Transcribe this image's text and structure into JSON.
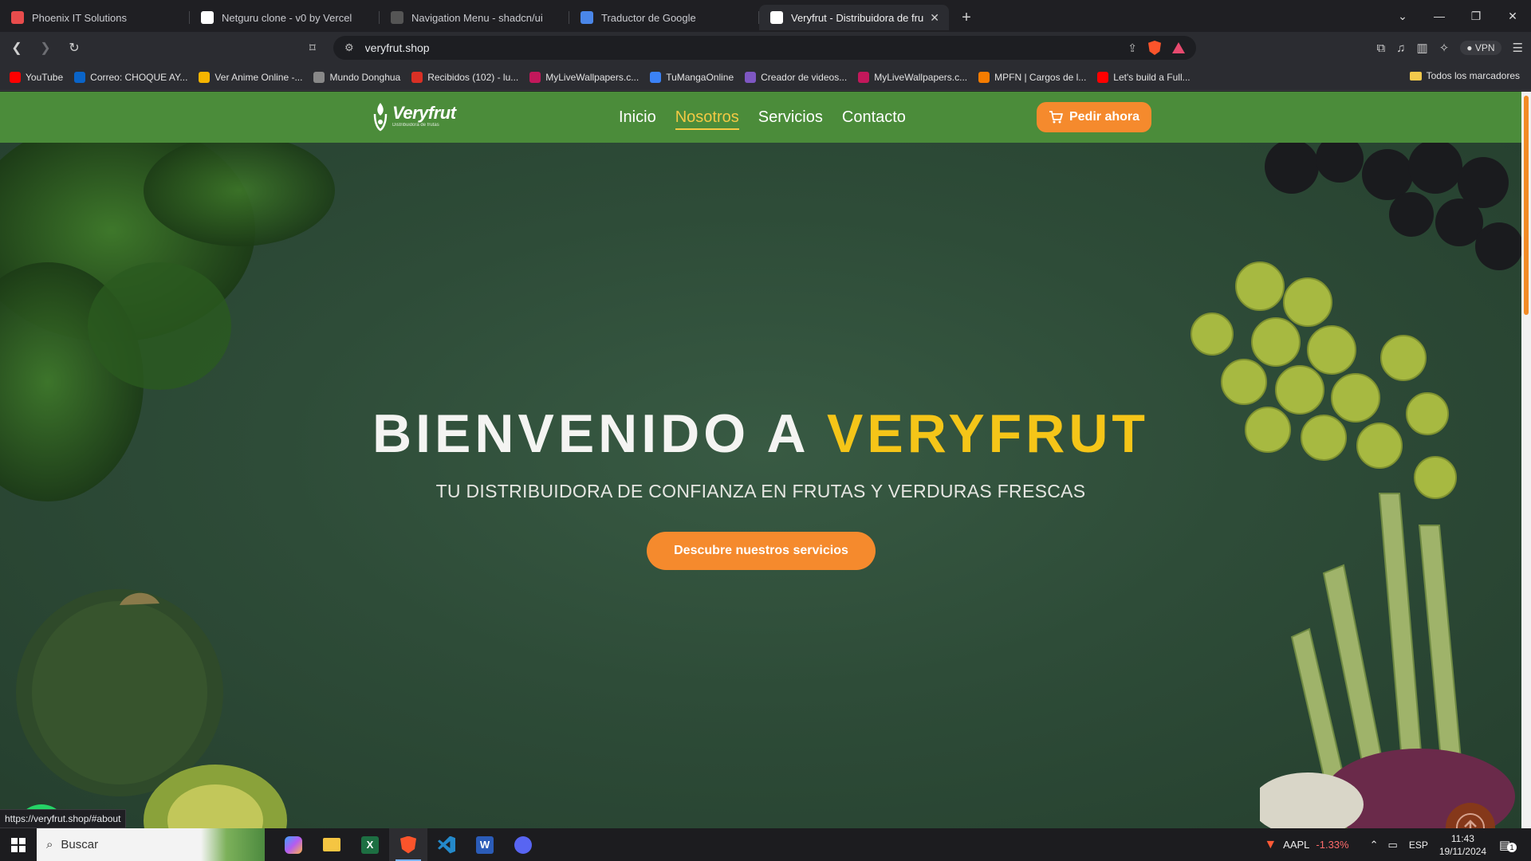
{
  "browser": {
    "tabs": [
      {
        "title": "Phoenix IT Solutions",
        "favicon_color": "#e84c4c",
        "active": false
      },
      {
        "title": "Netguru clone - v0 by Vercel",
        "favicon_color": "#ffffff",
        "active": false
      },
      {
        "title": "Navigation Menu - shadcn/ui",
        "favicon_color": "#555555",
        "active": false
      },
      {
        "title": "Traductor de Google",
        "favicon_color": "#4a86e8",
        "active": false
      },
      {
        "title": "Veryfrut - Distribuidora de frutas",
        "favicon_color": "#ffffff",
        "active": true
      }
    ],
    "url": "veryfrut.shop",
    "vpn_label": "VPN",
    "bookmarks": [
      {
        "label": "YouTube",
        "color": "#ff0000"
      },
      {
        "label": "Correo: CHOQUE AY...",
        "color": "#0a64c8"
      },
      {
        "label": "Ver Anime Online -...",
        "color": "#f5b400"
      },
      {
        "label": "Mundo Donghua",
        "color": "#888888"
      },
      {
        "label": "Recibidos (102) - lu...",
        "color": "#d93025"
      },
      {
        "label": "MyLiveWallpapers.c...",
        "color": "#c2185b"
      },
      {
        "label": "TuMangaOnline",
        "color": "#3b82f6"
      },
      {
        "label": "Creador de videos...",
        "color": "#7e57c2"
      },
      {
        "label": "MyLiveWallpapers.c...",
        "color": "#c2185b"
      },
      {
        "label": "MPFN | Cargos de l...",
        "color": "#f57c00"
      },
      {
        "label": "Let's build a Full...",
        "color": "#ff0000"
      }
    ],
    "bookmarks_folder": "Todos los marcadores",
    "status_url": "https://veryfrut.shop/#about"
  },
  "site": {
    "logo_name": "Veryfrut",
    "logo_tagline": "Distribuidora de frutas",
    "nav": [
      {
        "label": "Inicio",
        "active": false
      },
      {
        "label": "Nosotros",
        "active": true
      },
      {
        "label": "Servicios",
        "active": false
      },
      {
        "label": "Contacto",
        "active": false
      }
    ],
    "order_button": "Pedir ahora",
    "hero": {
      "title_prefix": "BIENVENIDO A ",
      "title_accent": "VERYFRUT",
      "subtitle": "TU DISTRIBUIDORA DE CONFIANZA EN FRUTAS Y VERDURAS FRESCAS",
      "cta": "Descubre nuestros servicios"
    },
    "colors": {
      "header": "#4b8c3a",
      "accent": "#f5c518",
      "button": "#f58a2d"
    }
  },
  "taskbar": {
    "search_placeholder": "Buscar",
    "stock_symbol": "AAPL",
    "stock_change": "-1.33%",
    "language": "ESP",
    "time": "11:43",
    "date": "19/11/2024",
    "notification_count": "1"
  }
}
